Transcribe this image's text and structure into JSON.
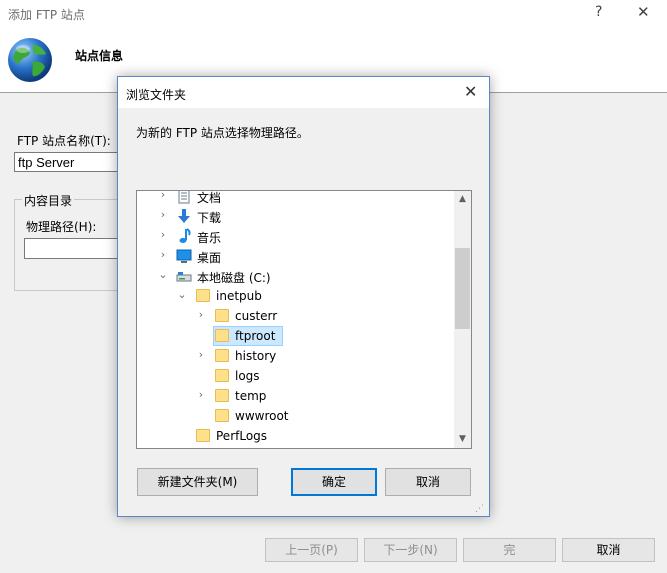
{
  "wizard": {
    "title": "添加 FTP 站点",
    "help": "?",
    "close": "✕",
    "heading": "站点信息",
    "name_label": "FTP 站点名称(T):",
    "name_value": "ftp Server",
    "content_group": "内容目录",
    "path_label": "物理路径(H):",
    "buttons": {
      "prev": "上一页(P)",
      "next": "下一步(N)",
      "finish": "完",
      "cancel": "取消"
    }
  },
  "dialog": {
    "title": "浏览文件夹",
    "close": "✕",
    "prompt": "为新的 FTP 站点选择物理路径。",
    "tree": [
      {
        "label": "文档",
        "icon": "document-icon",
        "level": 0,
        "chevron": "›",
        "selected": false
      },
      {
        "label": "下载",
        "icon": "download-arrow-icon",
        "level": 0,
        "chevron": "›",
        "selected": false
      },
      {
        "label": "音乐",
        "icon": "music-note-icon",
        "level": 0,
        "chevron": "›",
        "selected": false
      },
      {
        "label": "桌面",
        "icon": "desktop-icon",
        "level": 0,
        "chevron": "›",
        "selected": false
      },
      {
        "label": "本地磁盘 (C:)",
        "icon": "drive-icon",
        "level": 0,
        "chevron": "⌄",
        "selected": false
      },
      {
        "label": "inetpub",
        "icon": "folder-icon",
        "level": 1,
        "chevron": "⌄",
        "selected": false
      },
      {
        "label": "custerr",
        "icon": "folder-icon",
        "level": 2,
        "chevron": "›",
        "selected": false
      },
      {
        "label": "ftproot",
        "icon": "folder-icon",
        "level": 2,
        "chevron": "",
        "selected": true
      },
      {
        "label": "history",
        "icon": "folder-icon",
        "level": 2,
        "chevron": "›",
        "selected": false
      },
      {
        "label": "logs",
        "icon": "folder-icon",
        "level": 2,
        "chevron": "",
        "selected": false
      },
      {
        "label": "temp",
        "icon": "folder-icon",
        "level": 2,
        "chevron": "›",
        "selected": false
      },
      {
        "label": "wwwroot",
        "icon": "folder-icon",
        "level": 2,
        "chevron": "",
        "selected": false
      },
      {
        "label": "PerfLogs",
        "icon": "folder-icon",
        "level": 1,
        "chevron": "",
        "selected": false
      }
    ],
    "scroll_up": "▲",
    "scroll_down": "▼",
    "buttons": {
      "new_folder": "新建文件夹(M)",
      "ok": "确定",
      "cancel": "取消"
    }
  },
  "colors": {
    "accent": "#0078d7",
    "selection": "#cce8ff",
    "folder": "#ffe08a"
  }
}
